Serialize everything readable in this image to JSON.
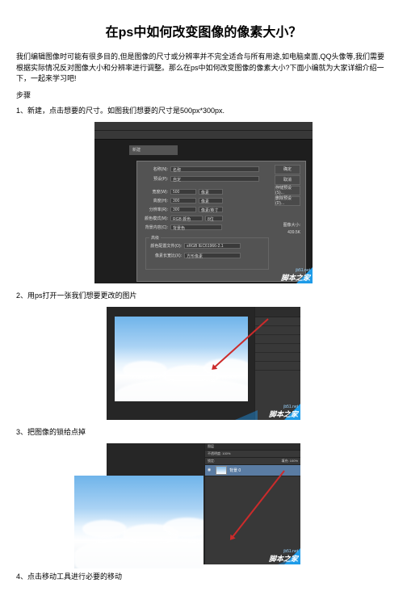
{
  "title": "在ps中如何改变图像的像素大小？",
  "intro": "我们编辑图像时可能有很多目的,但是图像的尺寸或分辨率并不完全适合与所有用途,如电脑桌面,QQ头像等,我们需要根据实际情况反对图像大小和分辨率进行调整。那么在ps中如何改变图像的像素大小?下面小编就为大家详细介绍一下，一起来学习吧!",
  "steps_header": "步骤",
  "steps": [
    "1、新建，点击想要的尺寸。如图我们想要的尺寸是500px*300px.",
    "2、用ps打开一张我们想要更改的图片",
    "3、把图像的锁给点掉",
    "4、点击移动工具进行必要的移动"
  ],
  "fig1": {
    "dialog_title": "新建",
    "name_label": "名称(N):",
    "name_value": "名称",
    "preset_label": "预设(P):",
    "preset_value": "自定",
    "ok": "确定",
    "cancel": "取消",
    "save_preset": "存储预设(S)...",
    "delete_preset": "删除预设(D)...",
    "width_label": "宽度(W):",
    "width_value": "500",
    "height_label": "高度(H):",
    "height_value": "300",
    "unit_px": "像素",
    "res_label": "分辨率(R):",
    "res_value": "300",
    "res_unit": "像素/英寸",
    "mode_label": "颜色模式(M):",
    "mode_value": "RGB 颜色",
    "bits": "8位",
    "bg_label": "背景内容(C):",
    "bg_value": "背景色",
    "advanced": "高级",
    "profile_label": "颜色配置文件(O):",
    "profile_value": "sRGB IEC61966-2.1",
    "aspect_label": "像素长宽比(X):",
    "aspect_value": "方形像素",
    "size_label": "图像大小:",
    "size_value": "439.5K"
  },
  "fig3": {
    "panel_tab": "图层",
    "opacity_label": "不透明度: 100%",
    "lock_label": "锁定:",
    "fill_label": "填充: 100%",
    "layer_name": "背景 0"
  },
  "watermark": {
    "url": "jb51.net",
    "name": "脚本之家"
  }
}
